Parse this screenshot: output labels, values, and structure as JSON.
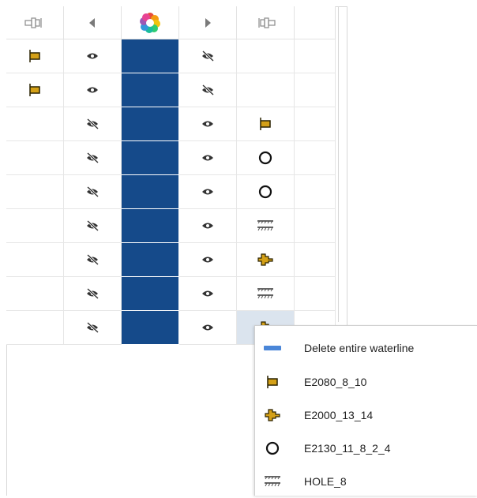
{
  "header": {
    "col1_icon": "connector-left-icon",
    "col2_icon": "arrow-left-icon",
    "col3_icon": "color-wheel-icon",
    "col4_icon": "arrow-right-icon",
    "col5_icon": "connector-right-icon"
  },
  "colors": {
    "swatch": "#154A8A",
    "gold": "#D4A017",
    "selected_row": "#DBE4EE",
    "menu_delete_bar": "#4A86D8"
  },
  "rows": [
    {
      "left_shape": "flag-icon",
      "left_vis": "eye-icon",
      "right_vis": "eye-off-icon",
      "right_shape": ""
    },
    {
      "left_shape": "flag-icon",
      "left_vis": "eye-icon",
      "right_vis": "eye-off-icon",
      "right_shape": ""
    },
    {
      "left_shape": "",
      "left_vis": "eye-off-icon",
      "right_vis": "eye-icon",
      "right_shape": "flag-icon"
    },
    {
      "left_shape": "",
      "left_vis": "eye-off-icon",
      "right_vis": "eye-icon",
      "right_shape": "circle-icon"
    },
    {
      "left_shape": "",
      "left_vis": "eye-off-icon",
      "right_vis": "eye-icon",
      "right_shape": "circle-icon"
    },
    {
      "left_shape": "",
      "left_vis": "eye-off-icon",
      "right_vis": "eye-icon",
      "right_shape": "hatch-icon"
    },
    {
      "left_shape": "",
      "left_vis": "eye-off-icon",
      "right_vis": "eye-icon",
      "right_shape": "plug-icon"
    },
    {
      "left_shape": "",
      "left_vis": "eye-off-icon",
      "right_vis": "eye-icon",
      "right_shape": "hatch-icon"
    },
    {
      "left_shape": "",
      "left_vis": "eye-off-icon",
      "right_vis": "eye-icon",
      "right_shape": "plug-icon"
    }
  ],
  "context_menu": {
    "items": [
      {
        "icon": "delete-bar-icon",
        "label": "Delete entire waterline"
      },
      {
        "icon": "flag-icon",
        "label": "E2080_8_10"
      },
      {
        "icon": "plug-icon",
        "label": "E2000_13_14"
      },
      {
        "icon": "circle-icon",
        "label": "E2130_11_8_2_4"
      },
      {
        "icon": "hatch-icon",
        "label": "HOLE_8"
      }
    ]
  }
}
